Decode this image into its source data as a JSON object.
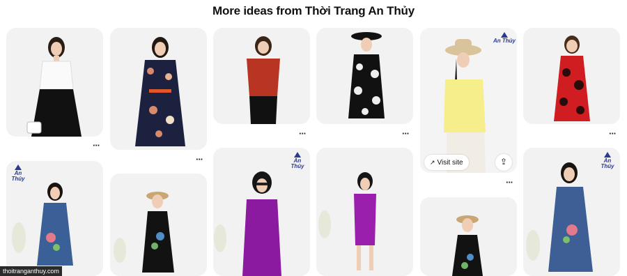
{
  "header": {
    "title": "More ideas from Thời Trang An Thủy"
  },
  "pin_actions": {
    "more_label": "···",
    "visit_label": "Visit site",
    "visit_icon": "↗",
    "share_icon": "⇪"
  },
  "brand": {
    "line1": "An Thủy"
  },
  "status": {
    "url": "thoitranganthuy.com"
  },
  "colors": {
    "page_bg": "#ffffff",
    "card_bg": "#efefef",
    "brand": "#2a3b8f",
    "pin_button_bg": "#ffffff",
    "status_bg": "#2b2b2b"
  },
  "pins": [
    {
      "top": "white-blouse",
      "bottom": "black-skirt"
    },
    {
      "top": "navy-floral-dress",
      "bottom": "navy-floral-dress"
    },
    {
      "top": "red-top",
      "bottom": "black-pants"
    },
    {
      "top": "black-floral-dress",
      "bottom": "black-floral-dress"
    },
    {
      "top": "yellow-tshirt",
      "bottom": "white-pants"
    },
    {
      "top": "red-lace-dress",
      "bottom": "red-lace-dress"
    },
    {
      "top": "denim-dress",
      "bottom": "denim-dress"
    },
    {
      "top": "black-embroidered-dress",
      "bottom": "black-embroidered-dress"
    },
    {
      "top": "purple-dress",
      "bottom": "purple-dress"
    },
    {
      "top": "purple-sheath-dress",
      "bottom": "purple-sheath-dress"
    },
    {
      "top": "black-embroidered-dress-2",
      "bottom": "black-embroidered-dress-2"
    },
    {
      "top": "denim-embroidered-dress",
      "bottom": "denim-embroidered-dress"
    }
  ]
}
